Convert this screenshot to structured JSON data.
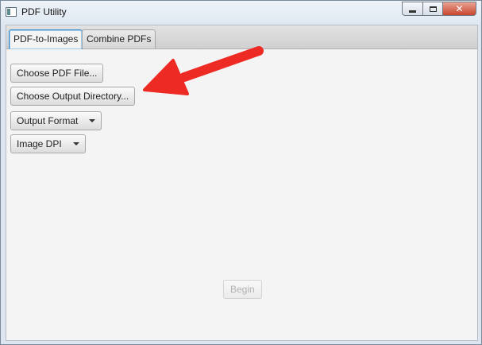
{
  "window": {
    "title": "PDF Utility",
    "controls": {
      "close_glyph": "✕"
    }
  },
  "tabs": [
    {
      "label": "PDF-to-Images",
      "active": true
    },
    {
      "label": "Combine PDFs",
      "active": false
    }
  ],
  "form": {
    "choose_pdf_label": "Choose PDF File...",
    "choose_output_dir_label": "Choose Output Directory...",
    "output_format_label": "Output Format",
    "image_dpi_label": "Image DPI",
    "begin_label": "Begin",
    "begin_enabled": false
  },
  "annotation": {
    "arrow_color": "#ee2a24",
    "icon": "red-arrow-icon"
  }
}
